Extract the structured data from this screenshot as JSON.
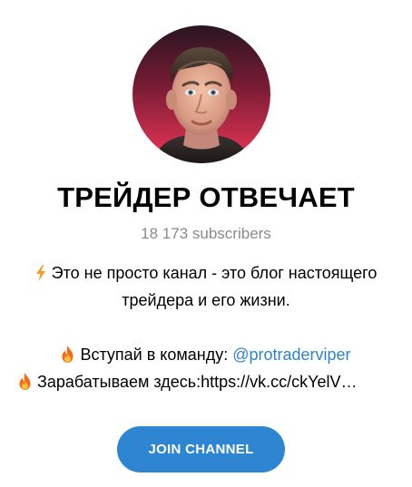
{
  "channel": {
    "title": "ТРЕЙДЕР ОТВЕЧАЕТ",
    "subscribers": "18 173 subscribers",
    "avatar_icon": "avatar-photo"
  },
  "description": {
    "line1_icon": "lightning-icon",
    "line1": "Это не просто канал - это блог настоящего",
    "line2": "трейдера и его жизни.",
    "line3_icon": "fire-icon",
    "line3_text": "Вступай в команду: ",
    "line3_mention": "@protraderviper",
    "line4_icon": "fire-icon",
    "line4_text": "Зарабатываем здесь:https://vk.cc/ckYelV…"
  },
  "actions": {
    "join_label": "JOIN CHANNEL"
  },
  "colors": {
    "accent": "#2e85d1",
    "link": "#2f83c7",
    "muted": "#8a8a8a",
    "avatar_bg_top": "#3a1320",
    "avatar_bg_bottom": "#e2314f"
  }
}
